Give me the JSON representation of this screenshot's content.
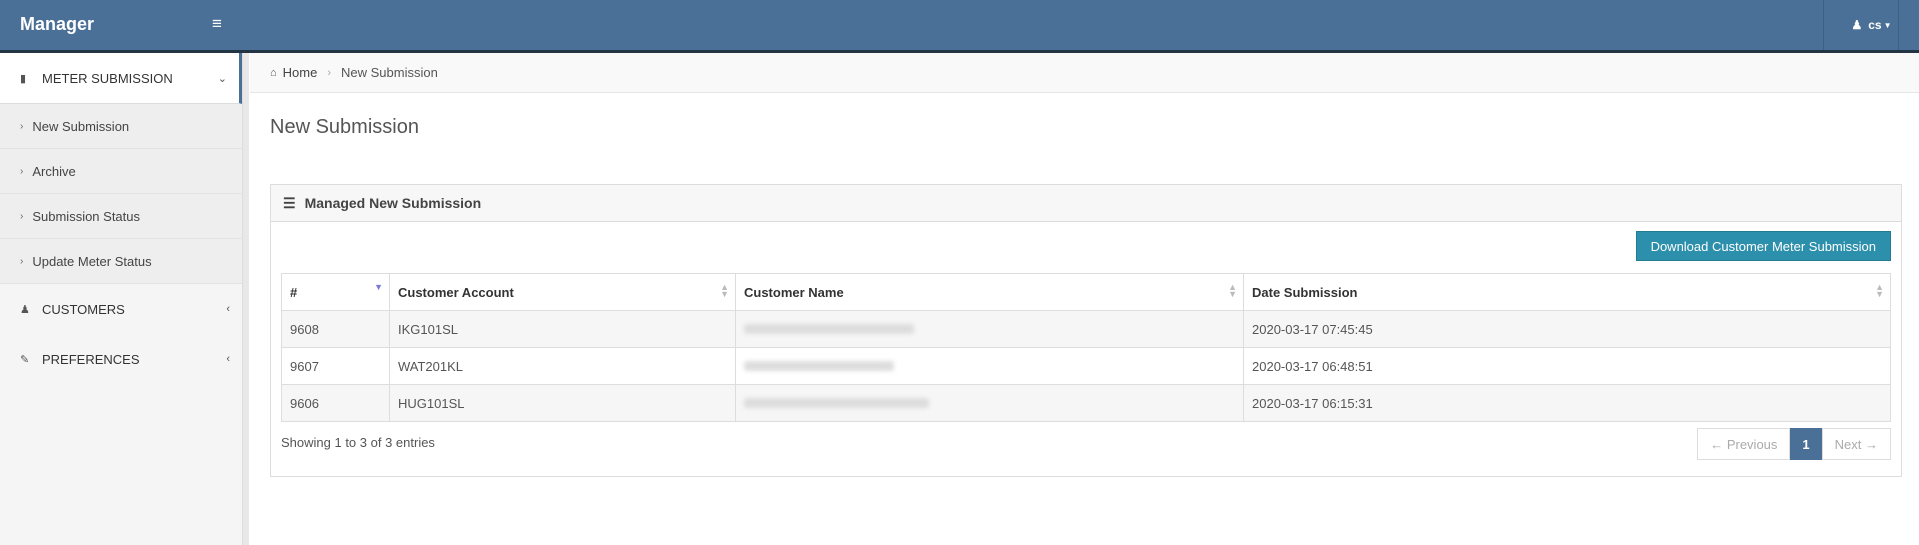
{
  "app": {
    "title": "Manager",
    "user": "cs"
  },
  "sidebar": {
    "sections": [
      {
        "label": "METER SUBMISSION",
        "icon": "file-icon",
        "arrow": "chevron-down-icon",
        "items": [
          "New Submission",
          "Archive",
          "Submission Status",
          "Update Meter Status"
        ]
      },
      {
        "label": "CUSTOMERS",
        "icon": "user-icon",
        "arrow": "chevron-left-icon"
      },
      {
        "label": "PREFERENCES",
        "icon": "edit-icon",
        "arrow": "chevron-left-icon"
      }
    ]
  },
  "breadcrumb": {
    "home": "Home",
    "current": "New Submission"
  },
  "page": {
    "title": "New Submission"
  },
  "panel": {
    "title": "Managed New Submission",
    "download_button": "Download Customer Meter Submission",
    "columns": [
      "#",
      "Customer Account",
      "Customer Name",
      "Date Submission"
    ],
    "rows": [
      {
        "id": "9608",
        "account": "IKG101SL",
        "date": "2020-03-17 07:45:45"
      },
      {
        "id": "9607",
        "account": "WAT201KL",
        "date": "2020-03-17 06:48:51"
      },
      {
        "id": "9606",
        "account": "HUG101SL",
        "date": "2020-03-17 06:15:31"
      }
    ],
    "info": "Showing 1 to 3 of 3 entries",
    "pagination": {
      "previous": "← Previous",
      "current": "1",
      "next": "Next →"
    }
  },
  "colors": {
    "topbar": "#4b7097",
    "button": "#2c8fab"
  }
}
